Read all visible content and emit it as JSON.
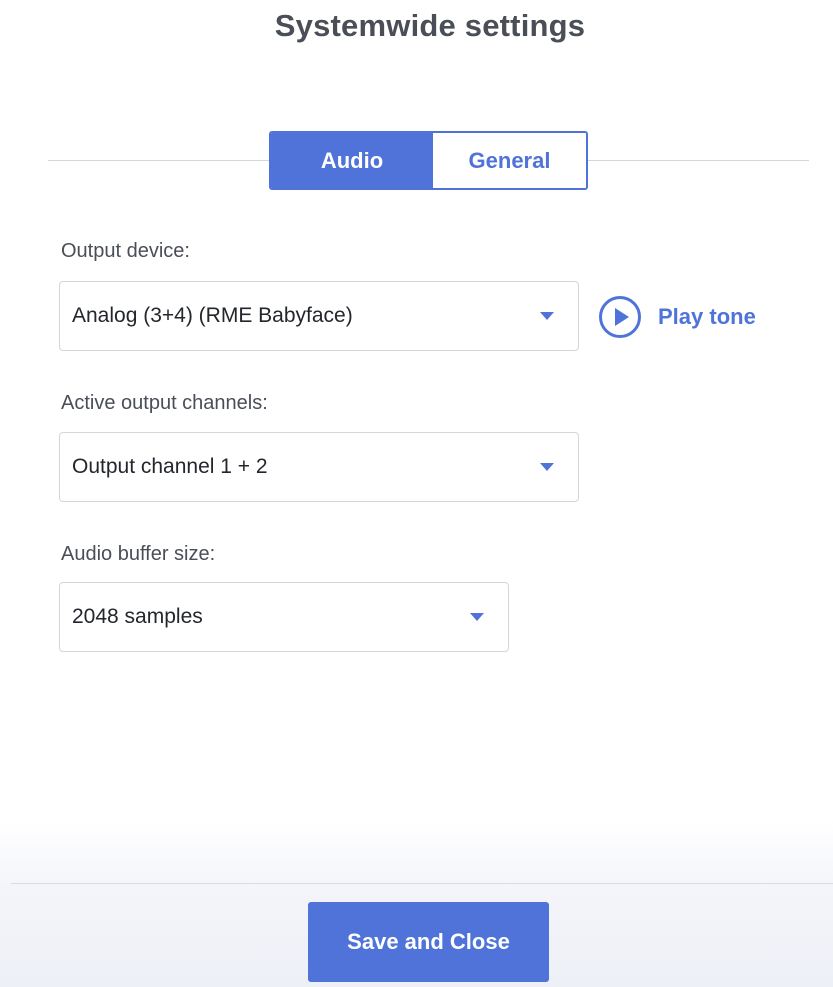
{
  "header": {
    "title": "Systemwide settings"
  },
  "tabs": [
    {
      "label": "Audio",
      "active": true
    },
    {
      "label": "General",
      "active": false
    }
  ],
  "fields": {
    "output_device": {
      "label": "Output device:",
      "value": "Analog (3+4) (RME Babyface)",
      "icon": "chevron-down-icon"
    },
    "active_output_channels": {
      "label": "Active output channels:",
      "value": "Output channel 1 + 2",
      "icon": "chevron-down-icon"
    },
    "audio_buffer_size": {
      "label": "Audio buffer size:",
      "value": "2048 samples",
      "icon": "chevron-down-icon"
    }
  },
  "play_tone": {
    "label": "Play tone",
    "icon": "play-circle-icon"
  },
  "footer": {
    "save_label": "Save and Close"
  },
  "colors": {
    "accent": "#4f73d9",
    "text": "#4a4e57",
    "border": "#d4d6db"
  }
}
